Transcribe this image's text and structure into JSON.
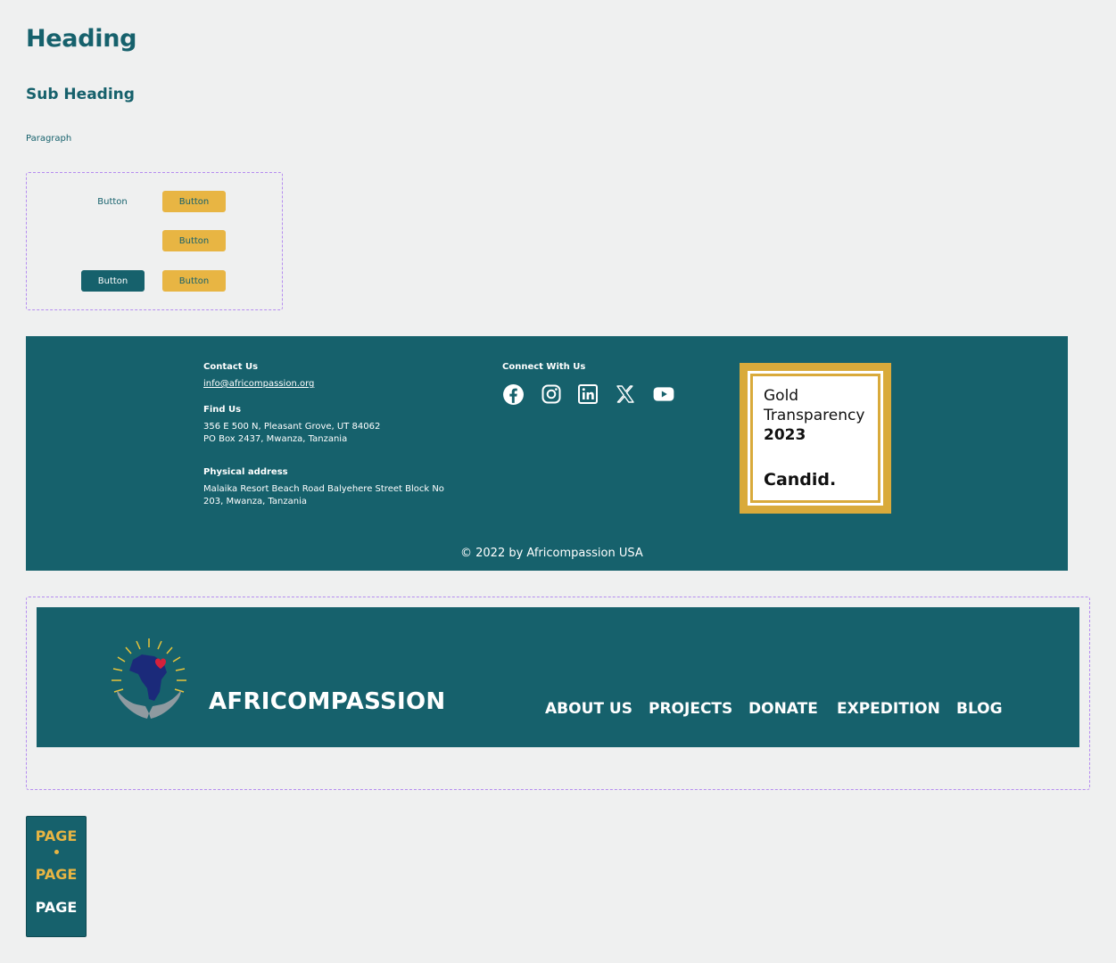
{
  "typography": {
    "heading": "Heading",
    "sub_heading": "Sub Heading",
    "paragraph": "Paragraph"
  },
  "buttons": {
    "text_button": "Button",
    "yellow_1": "Button",
    "yellow_2": "Button",
    "teal": "Button",
    "yellow_3": "Button"
  },
  "footer": {
    "contact_label": "Contact Us",
    "contact_email": "info@africompassion.org",
    "find_label": "Find Us",
    "find_line1": "356 E 500 N, Pleasant Grove, UT 84062",
    "find_line2": "PO Box 2437, Mwanza, Tanzania",
    "physical_label": "Physical address",
    "physical_line1": "Malaika Resort Beach Road Balyehere Street Block No",
    "physical_line2": "203, Mwanza, Tanzania",
    "connect_label": "Connect With Us",
    "social": [
      "facebook-icon",
      "instagram-icon",
      "linkedin-icon",
      "x-icon",
      "youtube-icon"
    ],
    "badge": {
      "line1": "Gold",
      "line2": "Transparency",
      "line3": "2023",
      "brand": "Candid."
    },
    "copyright": "© 2022 by Africompassion USA"
  },
  "header": {
    "brand": "AFRICOMPASSION",
    "nav": [
      "ABOUT US",
      "PROJECTS",
      "DONATE",
      "EXPEDITION",
      "BLOG"
    ]
  },
  "pager": {
    "items": [
      "PAGE",
      "PAGE",
      "PAGE"
    ],
    "active_index": 0
  },
  "colors": {
    "background": "#eff0f0",
    "teal": "#16616c",
    "yellow": "#e8b543",
    "dashed_outline": "#b58cf0"
  }
}
